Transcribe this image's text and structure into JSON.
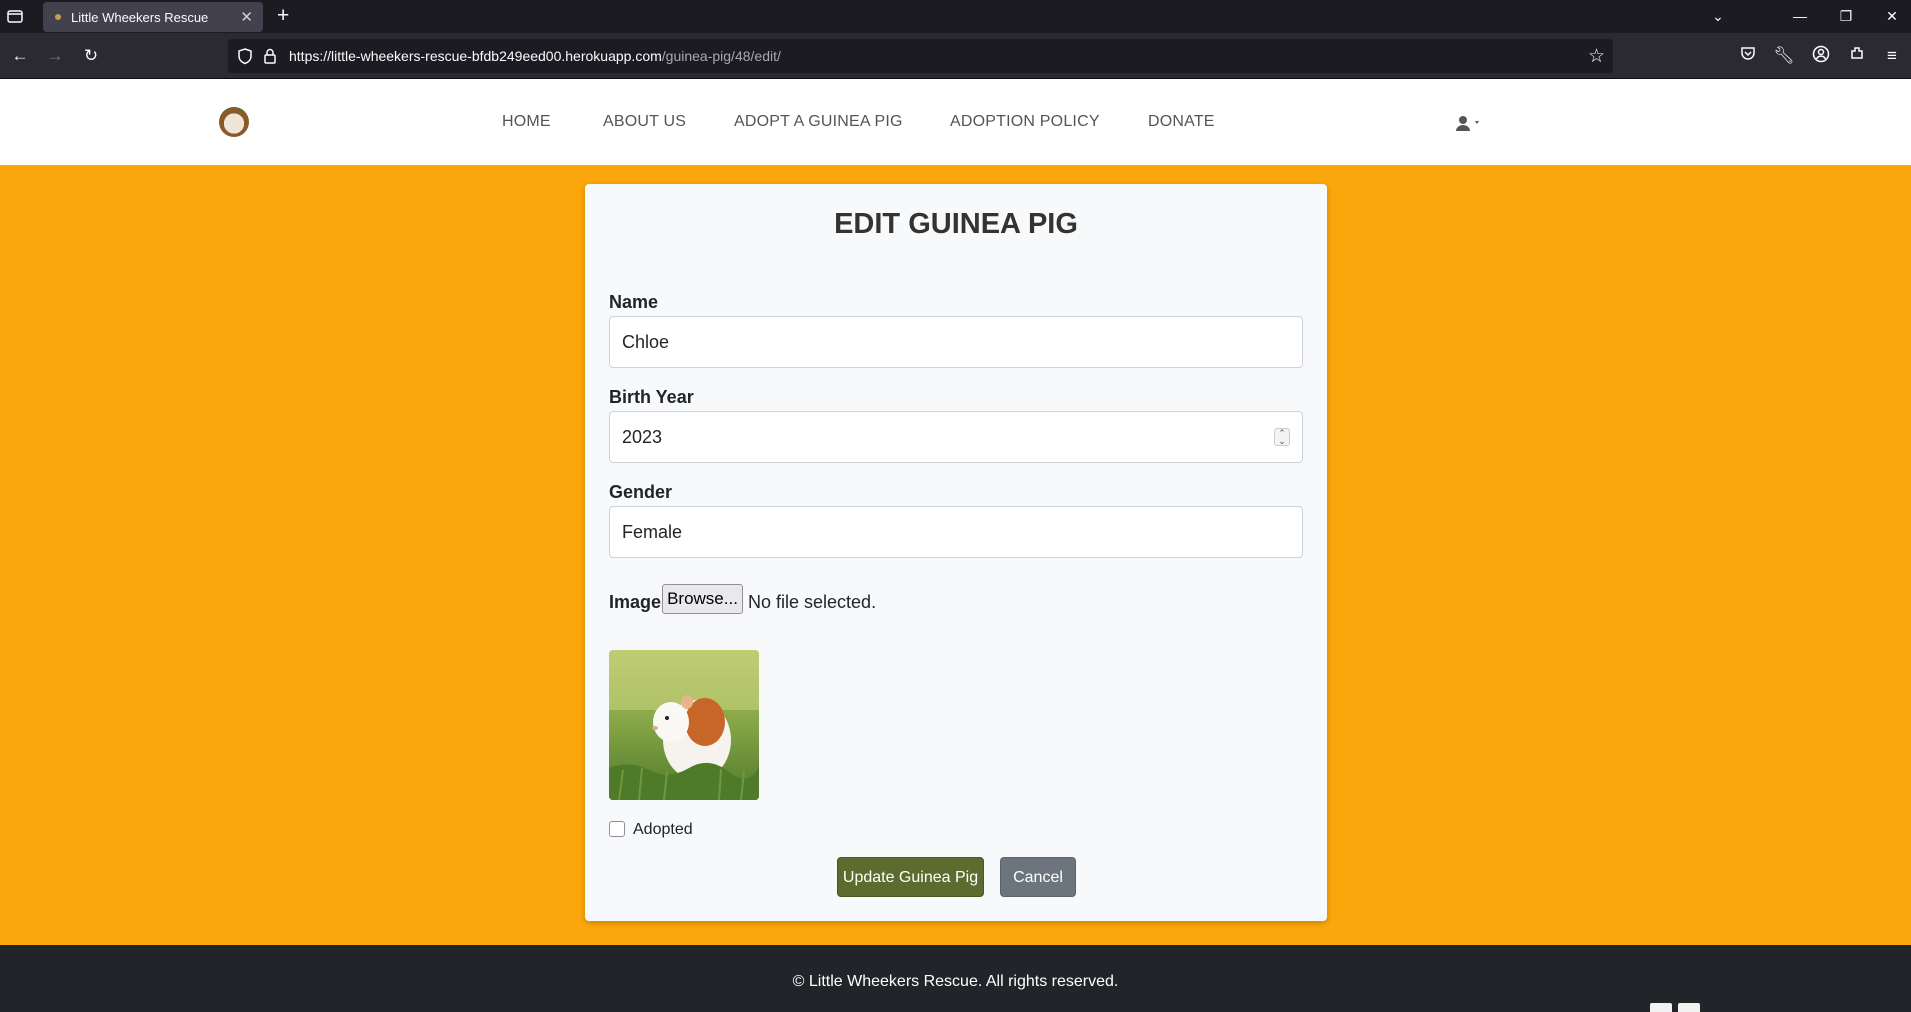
{
  "browser": {
    "tab_title": "Little Wheekers Rescue",
    "url_host": "https://little-wheekers-rescue-bfdb249eed00.herokuapp.com",
    "url_path": "/guinea-pig/48/edit/"
  },
  "nav": {
    "items": [
      "HOME",
      "ABOUT US",
      "ADOPT A GUINEA PIG",
      "ADOPTION POLICY",
      "DONATE"
    ]
  },
  "form": {
    "title": "EDIT GUINEA PIG",
    "name_label": "Name",
    "name_value": "Chloe",
    "birth_year_label": "Birth Year",
    "birth_year_value": "2023",
    "gender_label": "Gender",
    "gender_value": "Female",
    "image_label": "Image",
    "browse_label": "Browse...",
    "file_status": "No file selected.",
    "adopted_label": "Adopted",
    "update_button": "Update Guinea Pig",
    "cancel_button": "Cancel"
  },
  "footer": {
    "copyright": "© Little Wheekers Rescue. All rights reserved."
  },
  "colors": {
    "page_bg": "#faa60c",
    "primary_button": "#5c6b2e",
    "secondary_button": "#6c757d",
    "footer_bg": "#212529"
  }
}
